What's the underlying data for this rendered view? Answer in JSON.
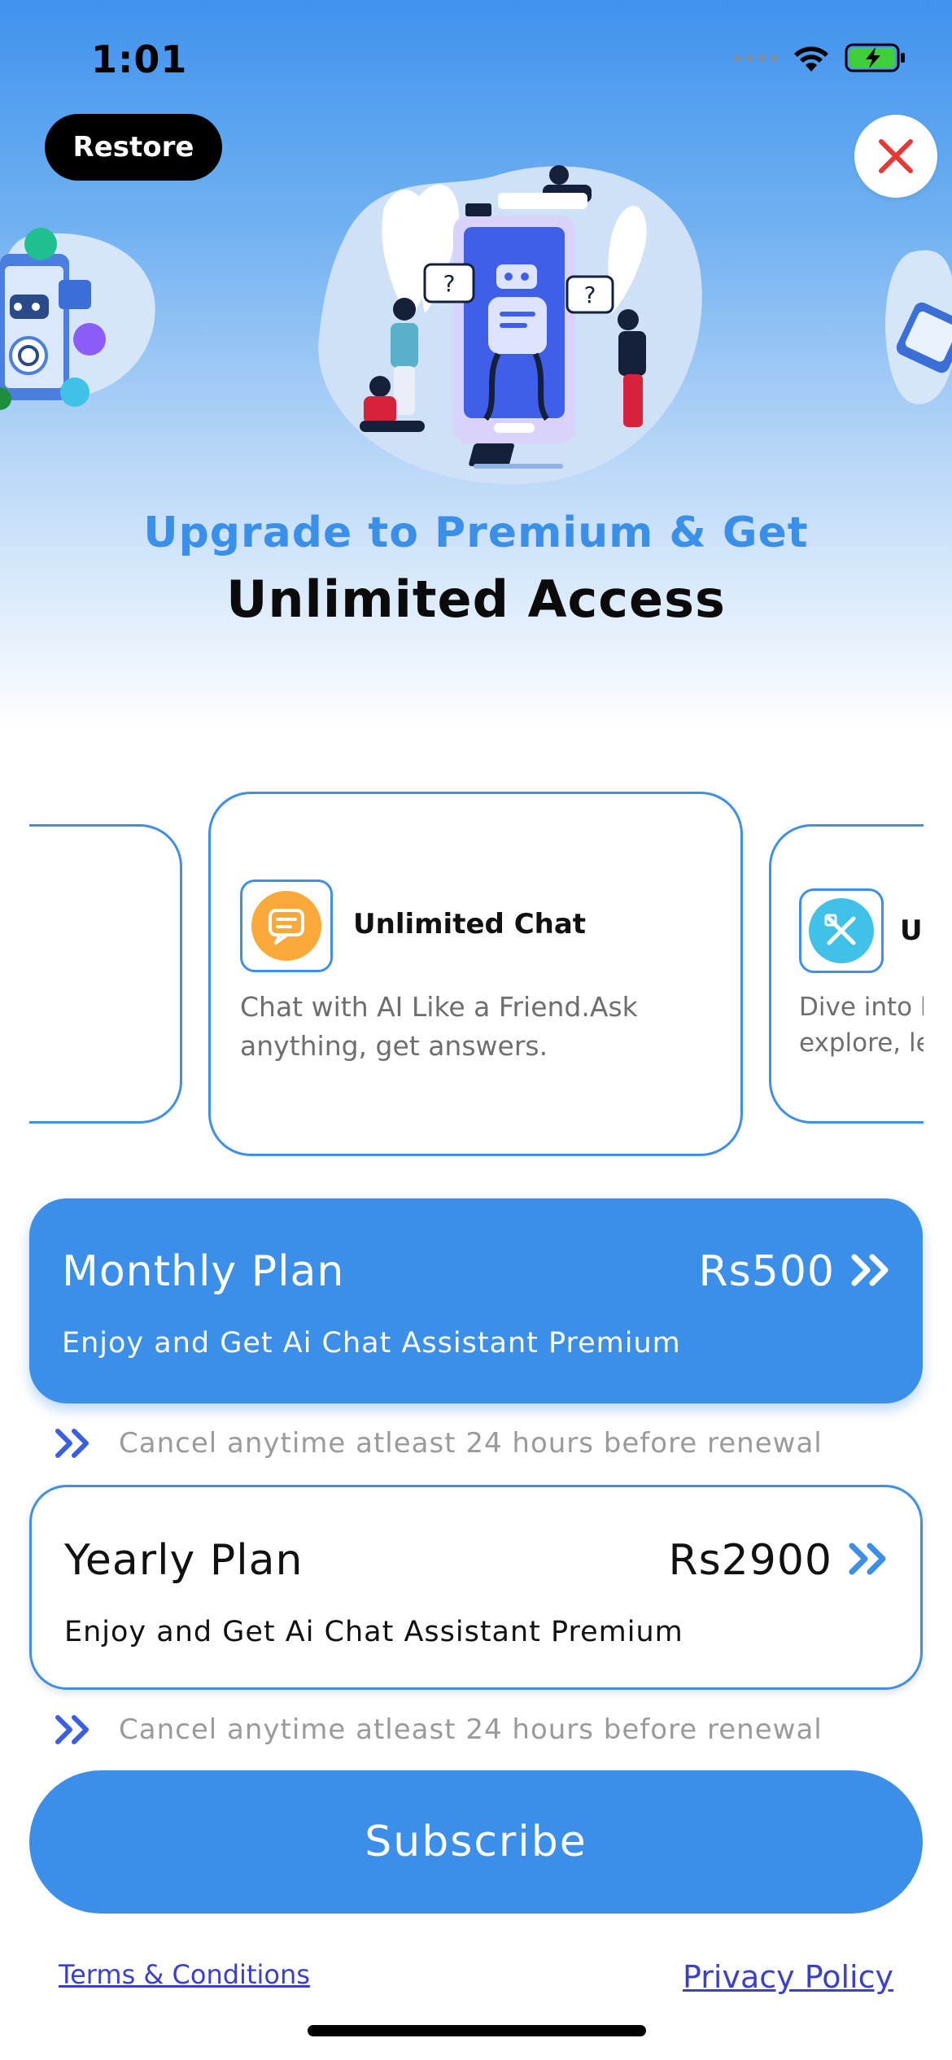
{
  "status_bar": {
    "time": "1:01"
  },
  "header": {
    "restore_label": "Restore",
    "close_icon": "close-icon"
  },
  "hero": {
    "title_line1": "Upgrade to Premium & Get",
    "title_line2": "Unlimited Access"
  },
  "features": {
    "center": {
      "icon": "chat-bubble-icon",
      "title": "Unlimited Chat",
      "description": "Chat with AI Like a Friend.Ask anything, get answers."
    },
    "right": {
      "icon": "pencil-ruler-icon",
      "title": "Un",
      "description_line1": "Dive into k",
      "description_line2": "explore, le"
    }
  },
  "plans": [
    {
      "name": "Monthly Plan",
      "price": "Rs500",
      "description": "Enjoy and Get Ai Chat Assistant Premium",
      "note": "Cancel anytime atleast 24 hours before renewal",
      "selected": true
    },
    {
      "name": "Yearly Plan",
      "price": "Rs2900",
      "description": "Enjoy and Get Ai Chat Assistant Premium",
      "note": "Cancel anytime atleast 24 hours before renewal",
      "selected": false
    }
  ],
  "subscribe_label": "Subscribe",
  "footer": {
    "terms_label": "Terms & Conditions",
    "privacy_label": "Privacy Policy"
  },
  "colors": {
    "accent": "#3b8fe8",
    "close_red": "#e53935",
    "chat_icon_orange": "#f9a93a",
    "tool_icon_cyan": "#3fc1e8"
  }
}
